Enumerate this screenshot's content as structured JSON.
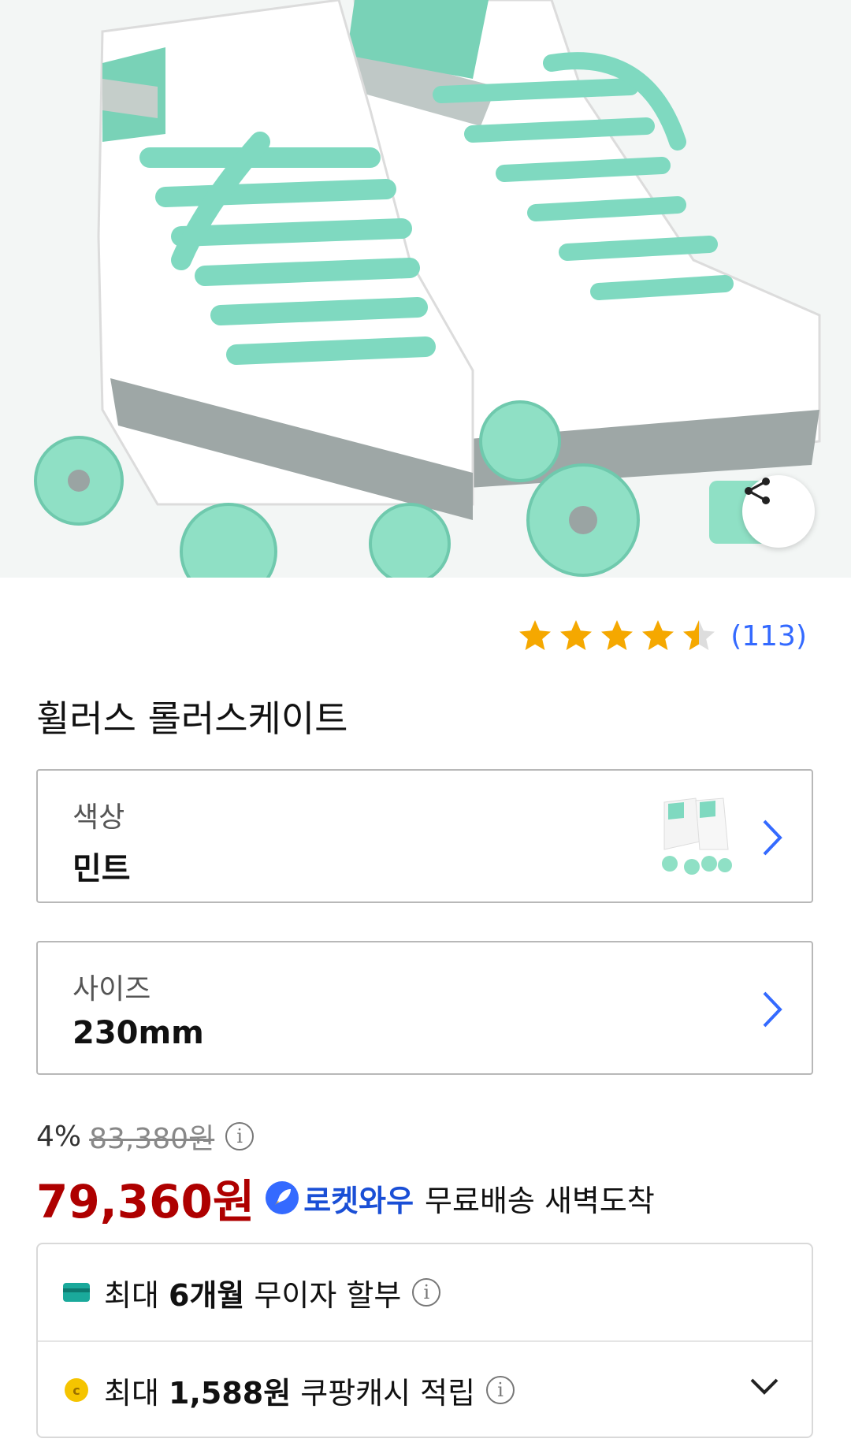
{
  "product": {
    "title": "휠러스 롤러스케이트",
    "rating_value": 4.5,
    "rating_max": 5,
    "review_count": "(113)"
  },
  "options": [
    {
      "label": "색상",
      "value": "민트"
    },
    {
      "label": "사이즈",
      "value": "230mm"
    }
  ],
  "pricing": {
    "discount": "4%",
    "original_price": "83,380원",
    "price": "79,360원",
    "rocket_label": "로켓와우",
    "delivery_text": "무료배송 새벽도착"
  },
  "benefits": {
    "installment": {
      "prefix": "최대 ",
      "bold": "6개월",
      "suffix": " 무이자 할부"
    },
    "cash": {
      "prefix": "최대 ",
      "bold": "1,588원",
      "suffix": " 쿠팡캐시 적립"
    }
  },
  "icons": {
    "share": "share-icon",
    "chevron_right": "chevron-right-icon",
    "chevron_down": "chevron-down-icon",
    "info": "info-icon",
    "card": "card-icon",
    "coin": "coin-icon",
    "rocket": "rocket-icon"
  },
  "colors": {
    "price_red": "#ae0000",
    "rating_star": "#f5a800",
    "link_blue": "#346aff",
    "mint": "#7fd9c0"
  }
}
